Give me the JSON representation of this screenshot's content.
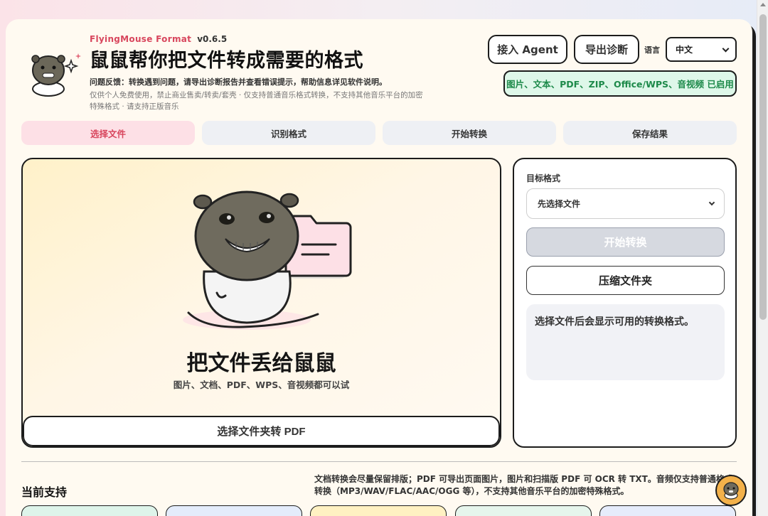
{
  "header": {
    "brand": "FlyingMouse Format",
    "version": "v0.6.5",
    "title": "鼠鼠帮你把文件转成需要的格式",
    "feedback": "问题反馈：转换遇到问题，请导出诊断报告并查看错误提示，帮助信息详见软件说明。",
    "disclaimer": "仅供个人免费使用，禁止商业售卖/转卖/套壳 · 仅支持普通音乐格式转换，不支持其他音乐平台的加密特殊格式 · 请支持正版音乐",
    "agent_button": "接入 Agent",
    "diagnostics_button": "导出诊断",
    "language_label": "语言",
    "language_value": "中文",
    "enabled_badge": "图片、文本、PDF、ZIP、Office/WPS、音视频 已启用"
  },
  "steps": [
    {
      "label": "选择文件"
    },
    {
      "label": "识别格式"
    },
    {
      "label": "开始转换"
    },
    {
      "label": "保存结果"
    }
  ],
  "dropzone": {
    "title": "把文件丢给鼠鼠",
    "subtitle": "图片、文档、PDF、WPS、音视频都可以试",
    "folder_button": "选择文件夹转 PDF"
  },
  "panel": {
    "target_label": "目标格式",
    "target_placeholder": "先选择文件",
    "start_button": "开始转换",
    "compress_button": "压缩文件夹",
    "hint": "选择文件后会显示可用的转换格式。"
  },
  "support": {
    "title": "当前支持",
    "note": "文档转换会尽量保留排版；PDF 可导出页面图片，图片和扫描版 PDF 可 OCR 转 TXT。音频仅支持普通格式转换（MP3/WAV/FLAC/AAC/OGG 等），不支持其他音乐平台的加密特殊格式。",
    "card_colors": [
      "#def4ea",
      "#e4ecfb",
      "#fff1c2",
      "#e6f5ec",
      "#e6ecfb"
    ]
  },
  "colors": {
    "accent": "#d8465d",
    "enabled_green": "#1d8a4a",
    "badge_bg": "#def7e9"
  }
}
